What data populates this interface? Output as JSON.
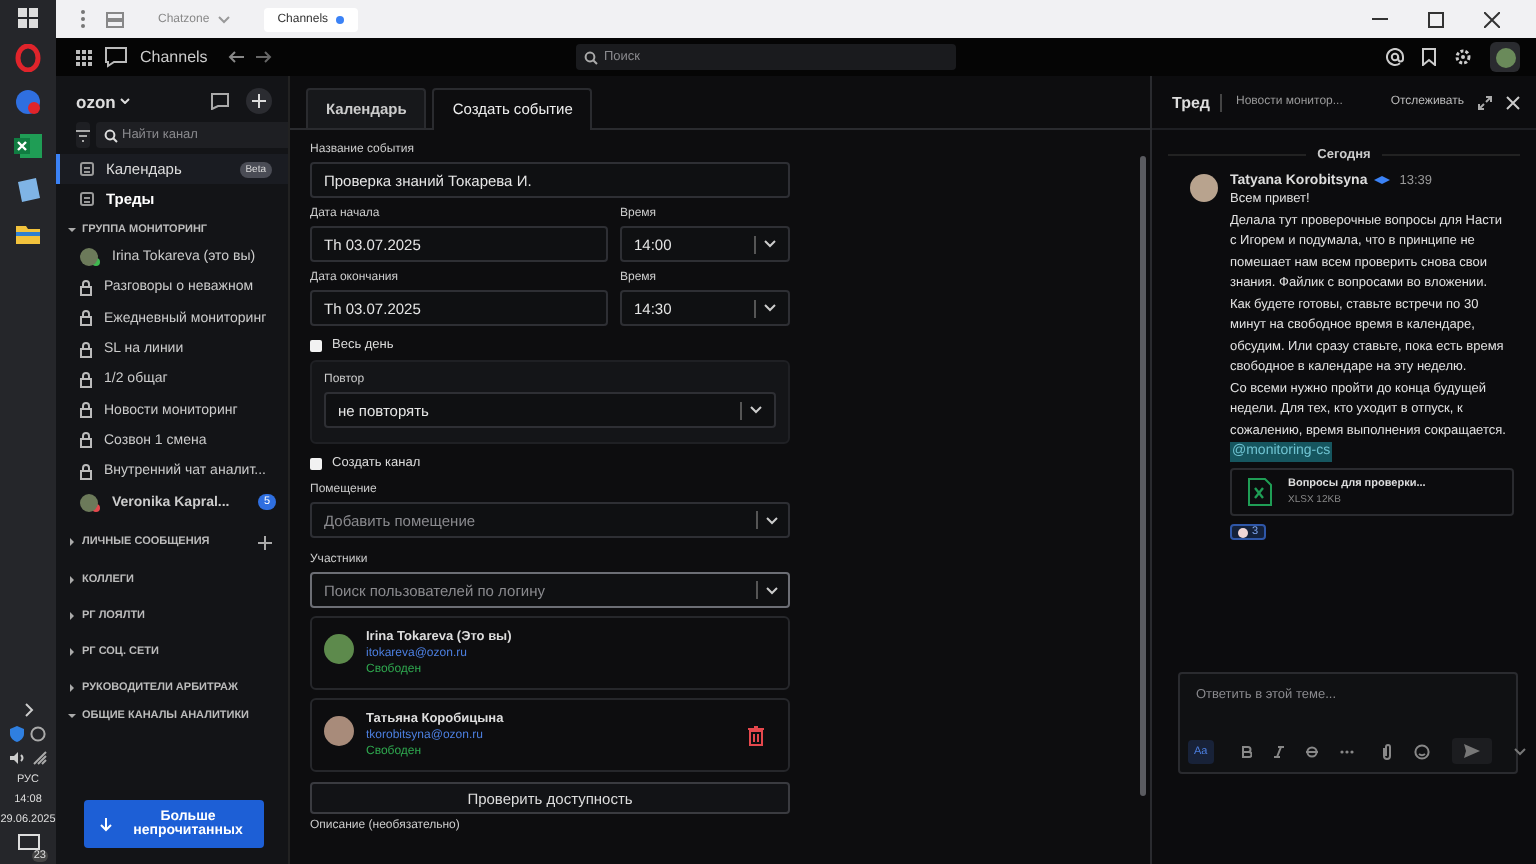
{
  "browser": {
    "tabs": [
      {
        "label": "Chatzone",
        "selected": false
      },
      {
        "label": "Channels",
        "selected": true
      }
    ]
  },
  "taskbar": {
    "language": "РУС",
    "time": "14:08",
    "date": "29.06.2025",
    "notifications": "23"
  },
  "header": {
    "title": "Channels",
    "search": {
      "placeholder": "Поиск"
    }
  },
  "sidebar": {
    "workspace": "ozon",
    "search": {
      "placeholder": "Найти канал"
    },
    "nav": [
      {
        "label": "Календарь",
        "badge": "Beta",
        "selected": true,
        "unread": false
      },
      {
        "label": "Треды",
        "selected": false,
        "unread": true
      }
    ],
    "groups": [
      {
        "title": "ГРУППА МОНИТОРИНГ",
        "expanded": true,
        "items": [
          {
            "kind": "user",
            "label": "Irina Tokareva (это вы)",
            "unread": false,
            "color": "#3fb950"
          },
          {
            "kind": "channel",
            "label": "Разговоры о неважном",
            "unread": false
          },
          {
            "kind": "channel",
            "label": "Ежедневный мониторинг",
            "unread": false
          },
          {
            "kind": "channel",
            "label": "SL на линии",
            "unread": false
          },
          {
            "kind": "channel",
            "label": "1/2 общаг",
            "unread": false
          },
          {
            "kind": "channel",
            "label": "Новости мониторинг",
            "unread": false
          },
          {
            "kind": "channel",
            "label": "Созвон 1 смена",
            "unread": false
          },
          {
            "kind": "channel",
            "label": "Внутренний чат аналит...",
            "unread": false
          },
          {
            "kind": "user",
            "label": "Veronika Kapral...",
            "unread": true,
            "color": "#e5484d",
            "badge": "5"
          }
        ]
      },
      {
        "title": "ЛИЧНЫЕ СООБЩЕНИЯ",
        "expanded": false,
        "addable": true
      },
      {
        "title": "КОЛЛЕГИ",
        "expanded": false,
        "addable": false
      },
      {
        "title": "РГ ЛОЯЛТИ",
        "expanded": false,
        "addable": false
      },
      {
        "title": "РГ СОЦ. СЕТИ",
        "expanded": false,
        "addable": false
      },
      {
        "title": "РУКОВОДИТЕЛИ АРБИТРАЖ",
        "expanded": false,
        "addable": false
      },
      {
        "title": "ОБЩИЕ КАНАЛЫ АНАЛИТИКИ",
        "expanded": true
      }
    ],
    "more_button": "Больше непрочитанных"
  },
  "form": {
    "tabs": [
      {
        "label": "Календарь",
        "selected": false
      },
      {
        "label": "Создать событие",
        "selected": true
      }
    ],
    "title": {
      "label": "Название события",
      "value": "Проверка знаний Токарева И."
    },
    "start": {
      "label": "Дата начала",
      "value": "Th 03.07.2025",
      "time_label": "Время",
      "time": "14:00"
    },
    "end": {
      "label": "Дата окончания",
      "value": "Th 03.07.2025",
      "time_label": "Время",
      "time": "14:30"
    },
    "all_day": {
      "label": "Весь день",
      "checked": false
    },
    "repeat": {
      "label": "Повтор",
      "value": "не повторять"
    },
    "create_channel": {
      "label": "Создать канал",
      "checked": false
    },
    "room": {
      "label": "Помещение",
      "placeholder": "Добавить помещение"
    },
    "participants": {
      "label": "Участники",
      "placeholder": "Поиск пользователей по логину",
      "people": [
        {
          "name": "Irina Tokareva (Это вы)",
          "email": "itokareva@ozon.ru",
          "status": "Свободен",
          "removable": false
        },
        {
          "name": "Татьяна Коробицына",
          "email": "tkorobitsyna@ozon.ru",
          "status": "Свободен",
          "removable": true
        }
      ]
    },
    "check_button": "Проверить доступность",
    "description_label": "Описание (необязательно)"
  },
  "thread": {
    "title": "Тред",
    "channel": "Новости монитор...",
    "follow": "Отслеживать",
    "day": "Сегодня",
    "message": {
      "author": "Tatyana Korobitsyna",
      "time": "13:39",
      "paragraphs": [
        "Всем привет!",
        "Делала тут проверочные вопросы для Насти с Игорем и подумала, что в принципе не помешает нам всем проверить снова свои знания. Файлик с вопросами во вложении. Как будете готовы, ставьте встречи по 30 минут на свободное время в календаре, обсудим. Или сразу ставьте, пока есть время свободное в календаре на эту неделю.",
        "Со всеми нужно пройти до конца будущей недели. Для тех, кто уходит  в отпуск, к сожалению, время выполнения сокращается."
      ],
      "mention": "@monitoring-cs",
      "attachment": {
        "name": "Вопросы для проверки...",
        "meta": "XLSX 12KB"
      },
      "reactions": [
        {
          "count": "3"
        }
      ]
    },
    "reply": {
      "placeholder": "Ответить в этой теме...",
      "format_button": "Aa"
    }
  }
}
